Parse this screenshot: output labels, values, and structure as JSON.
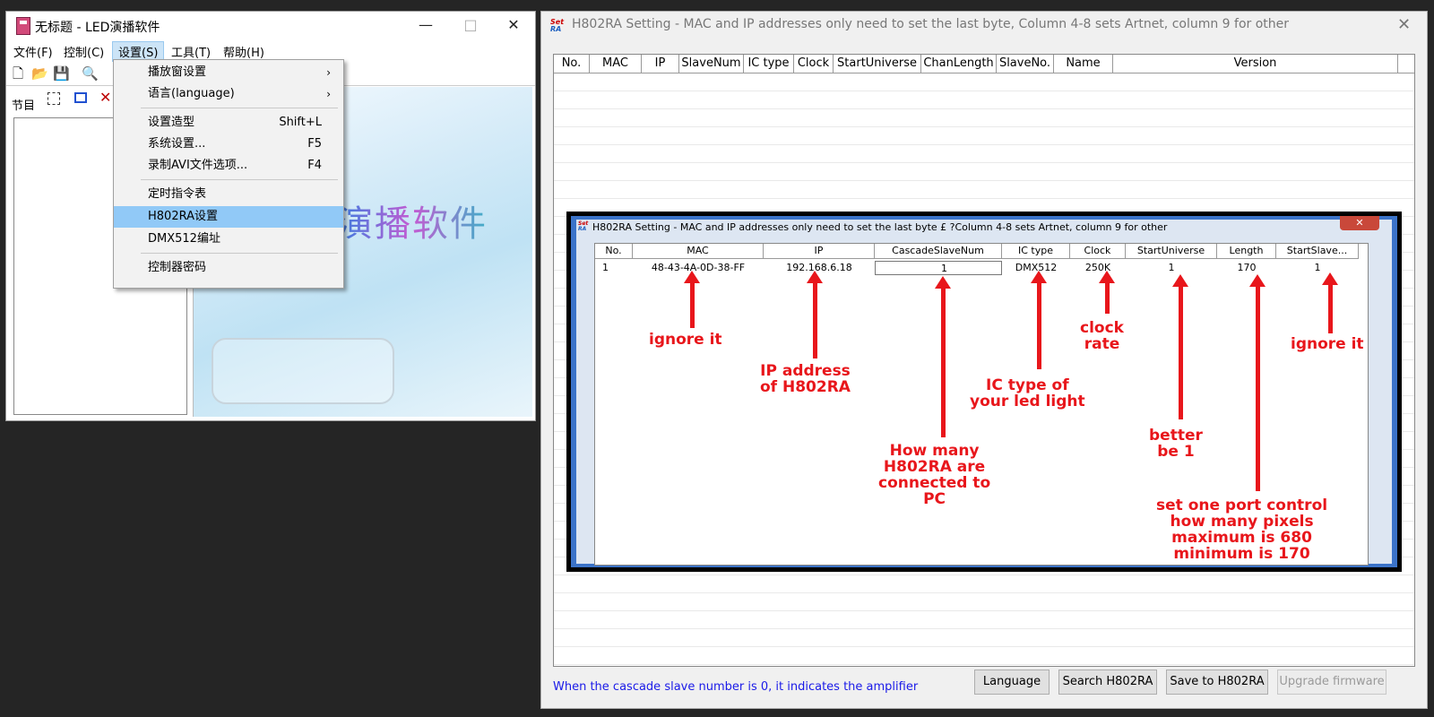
{
  "left_window": {
    "title": "无标题 - LED演播软件",
    "controls": {
      "minimize": "—",
      "maximize": "□",
      "close": "✕"
    },
    "menu": [
      "文件(F)",
      "控制(C)",
      "设置(S)",
      "工具(T)",
      "帮助(H)"
    ],
    "panel_label": "节目",
    "canvas_title": "演播软件"
  },
  "dropdown": {
    "items": [
      {
        "label": "播放窗设置",
        "shortcut": "",
        "submenu": true
      },
      {
        "label": "语言(language)",
        "shortcut": "",
        "submenu": true
      },
      {
        "label": "设置造型",
        "shortcut": "Shift+L",
        "submenu": false
      },
      {
        "label": "系统设置...",
        "shortcut": "F5",
        "submenu": false
      },
      {
        "label": "录制AVI文件选项...",
        "shortcut": "F4",
        "submenu": false
      },
      {
        "label": "定时指令表",
        "shortcut": "",
        "submenu": false
      },
      {
        "label": "H802RA设置",
        "shortcut": "",
        "submenu": false,
        "highlighted": true
      },
      {
        "label": "DMX512编址",
        "shortcut": "",
        "submenu": false
      },
      {
        "label": "控制器密码",
        "shortcut": "",
        "submenu": false
      }
    ]
  },
  "right_window": {
    "title": "H802RA Setting - MAC and IP addresses only need to set the last byte, Column 4-8 sets Artnet, column 9 for other",
    "close": "✕",
    "columns": [
      "No.",
      "MAC",
      "IP",
      "SlaveNum",
      "IC type",
      "Clock",
      "StartUniverse",
      "ChanLength",
      "SlaveNo.",
      "Name",
      "Version"
    ],
    "hint": "When the cascade slave number is 0, it indicates the amplifier",
    "buttons": {
      "language": "Language",
      "search": "Search H802RA",
      "save": "Save to H802RA",
      "upgrade": "Upgrade firmware"
    }
  },
  "overlay": {
    "title": "H802RA Setting - MAC and IP addresses only need to set the last byte £ ?Column 4-8 sets Artnet, column 9 for other",
    "close": "✕",
    "columns": [
      "No.",
      "MAC",
      "IP",
      "CascadeSlaveNum",
      "IC type",
      "Clock",
      "StartUniverse",
      "Length",
      "StartSlave..."
    ],
    "row": [
      "1",
      "48-43-4A-0D-38-FF",
      "192.168.6.18",
      "1",
      "DMX512",
      "250K",
      "1",
      "170",
      "1"
    ],
    "annotations": {
      "mac": "ignore it",
      "ip": "IP address\nof H802RA",
      "cascade": "How many\nH802RA are\nconnected to\nPC",
      "ictype": "IC type of\nyour led light",
      "clock": "clock\nrate",
      "universe": "better\nbe 1",
      "length": "set one port control\nhow many pixels\nmaximum is 680\nminimum is 170",
      "startslave": "ignore it"
    }
  }
}
